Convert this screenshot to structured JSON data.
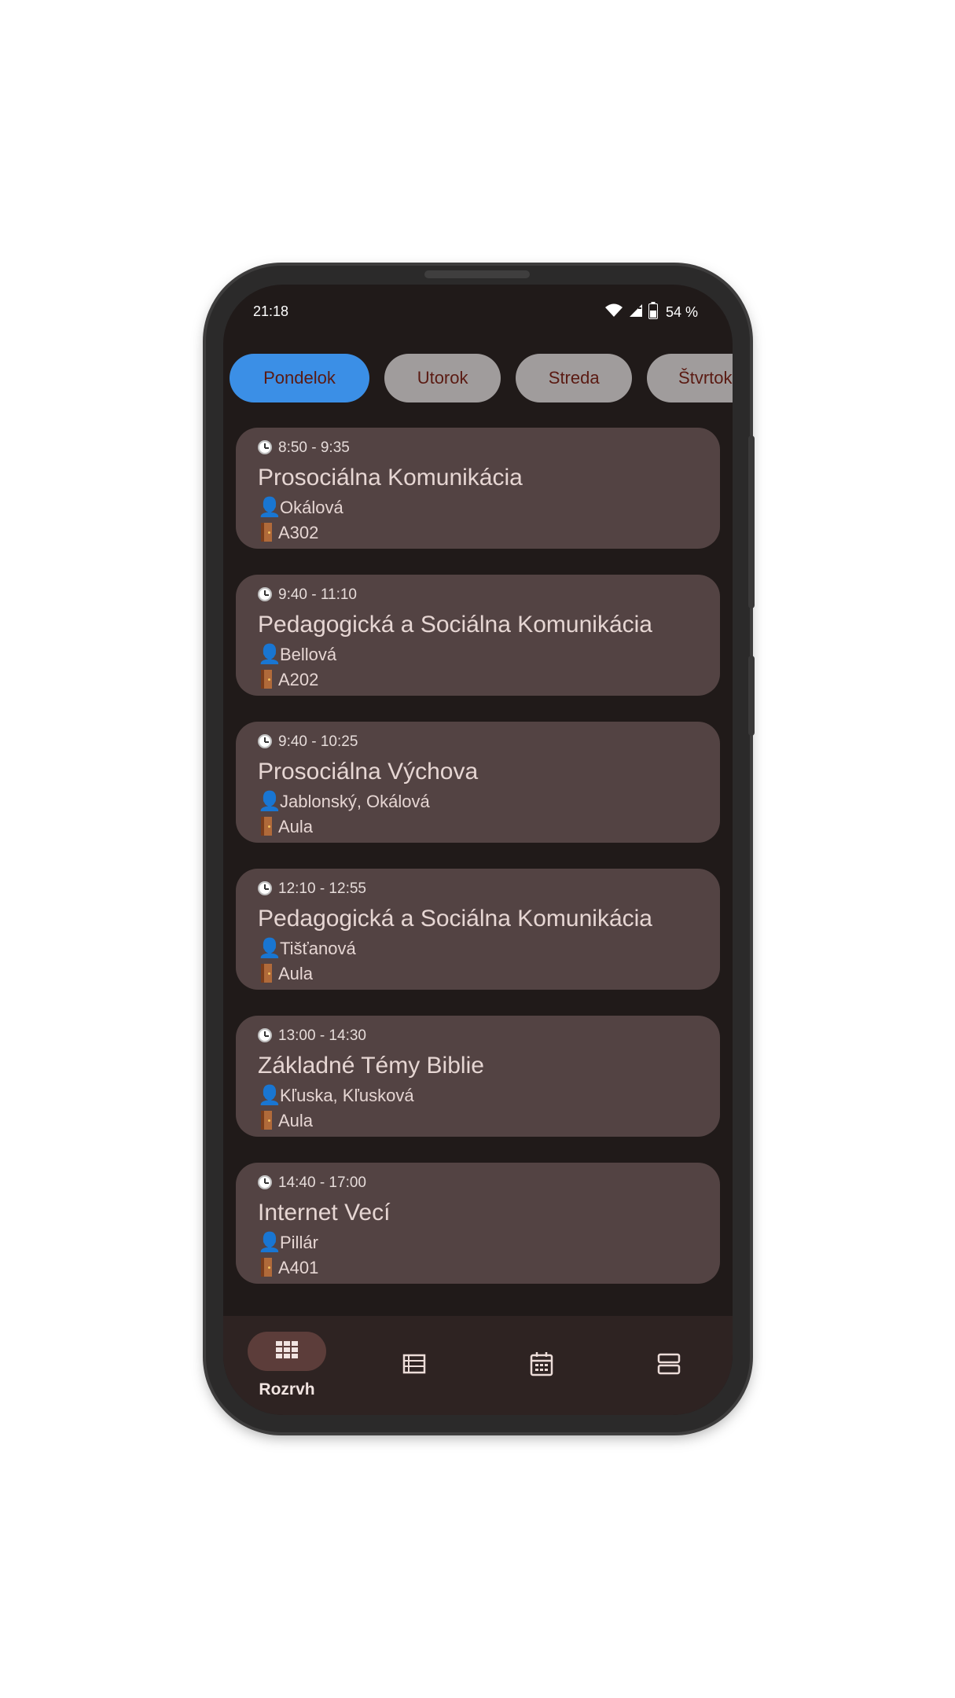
{
  "status_bar": {
    "time": "21:18",
    "battery": "54 %",
    "icons": [
      "wifi-icon",
      "signal-icon",
      "battery-icon"
    ]
  },
  "day_tabs": [
    {
      "label": "Pondelok",
      "selected": true
    },
    {
      "label": "Utorok",
      "selected": false
    },
    {
      "label": "Streda",
      "selected": false
    },
    {
      "label": "Štvrtok",
      "selected": false
    }
  ],
  "lessons": [
    {
      "time": "8:50 - 9:35",
      "title": "Prosociálna Komunikácia",
      "teacher": "Okálová",
      "room": "A302"
    },
    {
      "time": "9:40 - 11:10",
      "title": "Pedagogická a Sociálna Komunikácia",
      "teacher": "Bellová",
      "room": "A202"
    },
    {
      "time": "9:40 - 10:25",
      "title": "Prosociálna Výchova",
      "teacher": "Jablonský, Okálová",
      "room": "Aula"
    },
    {
      "time": "12:10 - 12:55",
      "title": "Pedagogická a Sociálna Komunikácia",
      "teacher": "Tišťanová",
      "room": "Aula"
    },
    {
      "time": "13:00 - 14:30",
      "title": "Základné Témy Biblie",
      "teacher": "Kľuska, Kľusková",
      "room": "Aula"
    },
    {
      "time": "14:40 - 17:00",
      "title": "Internet Vecí",
      "teacher": "Pillár",
      "room": "A401"
    }
  ],
  "bottom_nav": {
    "items": [
      {
        "label": "Rozrvh",
        "icon": "grid-icon",
        "active": true
      },
      {
        "label": "",
        "icon": "list-icon",
        "active": false
      },
      {
        "label": "",
        "icon": "calendar-icon",
        "active": false
      },
      {
        "label": "",
        "icon": "layout-icon",
        "active": false
      }
    ]
  },
  "colors": {
    "accent": "#3b8fe6",
    "background": "#201a19",
    "card": "#534343",
    "chip": "#a09c9c",
    "chip_text": "#5a1a12",
    "nav": "#2e2322"
  }
}
